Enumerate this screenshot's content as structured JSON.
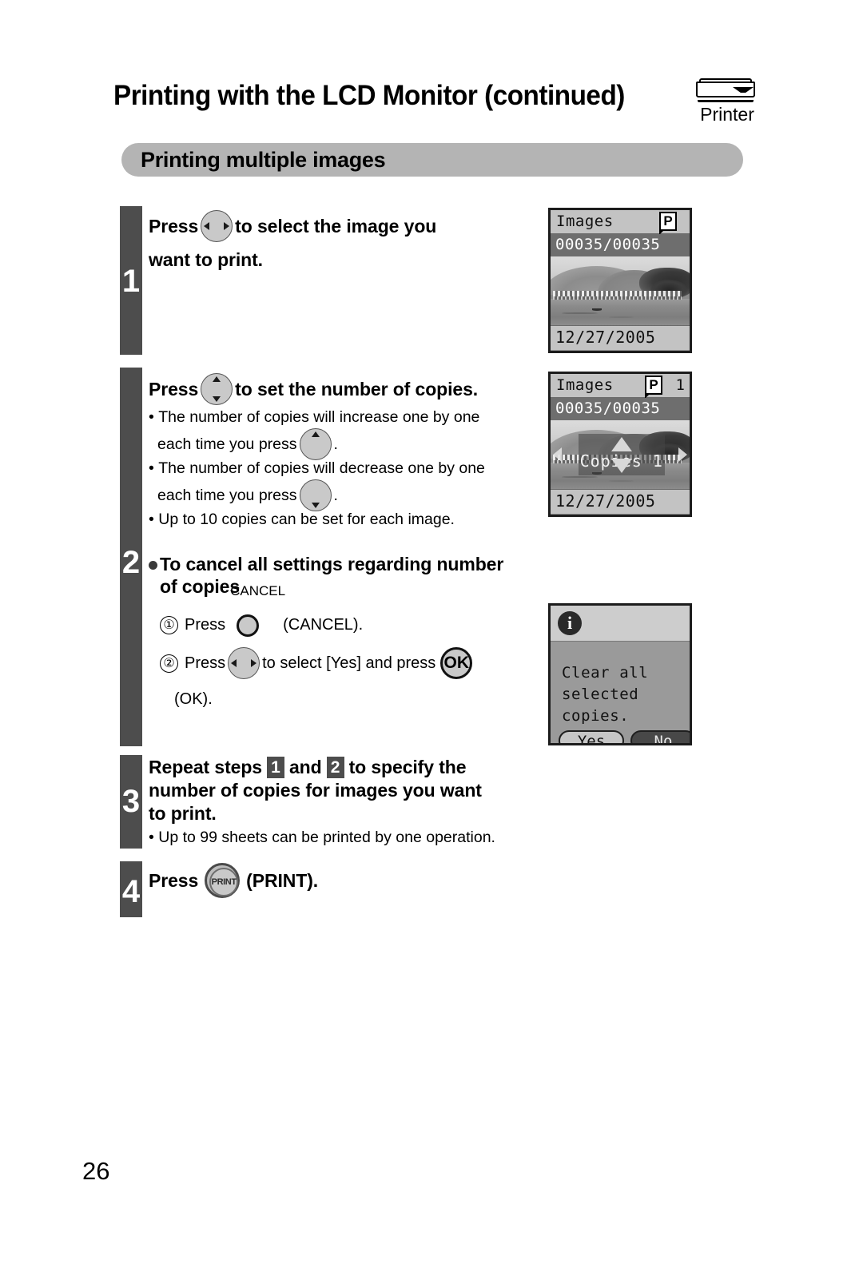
{
  "header": {
    "title": "Printing with the LCD Monitor (continued)",
    "printer_badge": {
      "icon": "printer-icon",
      "label": "Printer"
    }
  },
  "section": {
    "heading": "Printing multiple images"
  },
  "steps": [
    {
      "number": "1",
      "head_before": "Press",
      "button_icon": "four-way-left-right-button",
      "head_after": "to select the image you",
      "head_line2": "want to print."
    },
    {
      "number": "2",
      "head_before": "Press",
      "button_icon": "four-way-up-down-button",
      "head_after": "to set the number of copies.",
      "bullets": [
        {
          "text_a": "The number of copies will increase one by one",
          "text_b": "each time you press",
          "icon": "up-arrow-button",
          "text_c": "."
        },
        {
          "text_a": "The number of copies will decrease one by one",
          "text_b": "each time you press",
          "icon": "down-arrow-button",
          "text_c": "."
        },
        {
          "text_a": "Up to 10 copies can be set for each image."
        }
      ],
      "subhead_line1": "To cancel all settings regarding number",
      "subhead_line2": "of copies",
      "substeps": [
        {
          "marker": "①",
          "text_a": "Press",
          "icon": "cancel-button",
          "icon_label": "CANCEL",
          "text_b": "(CANCEL)."
        },
        {
          "marker": "②",
          "text_a": "Press",
          "icon": "four-way-left-right-button",
          "text_b": "to select [Yes] and press",
          "icon2": "ok-button",
          "icon2_label": "OK",
          "text_c": "(OK)."
        }
      ]
    },
    {
      "number": "3",
      "head_a": "Repeat steps",
      "chip1": "1",
      "head_b": "and",
      "chip2": "2",
      "head_c": "to specify the",
      "head_line2": "number of copies for images you want",
      "head_line3": "to print.",
      "bullets": [
        {
          "text_a": "Up to 99 sheets can be printed by one operation."
        }
      ]
    },
    {
      "number": "4",
      "head_before": "Press",
      "button_icon": "print-button",
      "button_label": "PRINT",
      "head_after": "(PRINT)."
    }
  ],
  "screens": {
    "screen1": {
      "title": "Images",
      "badge": "P",
      "counter": "00035/00035",
      "date": "12/27/2005"
    },
    "screen2": {
      "title": "Images",
      "badge": "P",
      "copy_count": "1",
      "counter": "00035/00035",
      "overlay_text": "Copies  1",
      "date": "12/27/2005"
    },
    "dialog": {
      "icon": "info-icon",
      "message_line1": "Clear all",
      "message_line2": "selected copies.",
      "yes_label": "Yes",
      "no_label": "No"
    }
  },
  "footer": {
    "page_number": "26"
  },
  "colors": {
    "step_bar": "#4d4d4d",
    "section_bar": "#b4b4b4",
    "button_face": "#c9c9c9",
    "lcd_border": "#1c1c1c"
  }
}
